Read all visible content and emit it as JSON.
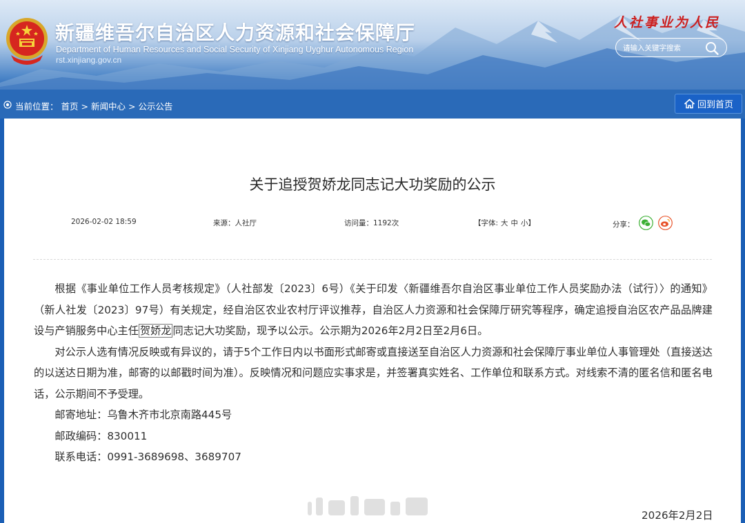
{
  "header": {
    "title_cn": "新疆维吾尔自治区人力资源和社会保障厅",
    "title_en": "Department of Human Resources and Social Security of Xinjiang Uyghur Autonomous Region",
    "url": "rst.xinjiang.gov.cn",
    "slogan": "人社事业为人民",
    "search_placeholder": "请输入关键字搜索",
    "search_icon": "search-icon",
    "emblem_icon": "national-emblem-icon",
    "brand_color": "#2a6ab8",
    "slogan_color": "#cc1f1f"
  },
  "breadcrumb": {
    "prefix": "当前位置：",
    "items": [
      "首页",
      "新闻中心",
      "公示公告"
    ],
    "separator": ">"
  },
  "home_button": {
    "label": "回到首页",
    "icon": "home-icon"
  },
  "article": {
    "title": "关于追授贺娇龙同志记大功奖励的公示",
    "date": "2026-02-02 18:59",
    "source": "来源：人社厅",
    "views": "访问量：1192次",
    "font_label": "【字体:",
    "font_sizes": [
      "大",
      "中",
      "小"
    ],
    "font_close": "】",
    "share_label": "分享：",
    "share_icons": [
      "wechat-icon",
      "weibo-icon"
    ],
    "p1_a": "根据《事业单位工作人员考核规定》（人社部发〔2023〕6号）《关于印发〈新疆维吾尔自治区事业单位工作人员奖励办法（试行）〉的通知》（新人社发〔2023〕97号）有关规定，经自治区农业农村厅评议推荐，自治区人力资源和社会保障厅研究等程序，确定追授自治区农产品品牌建设与产销服务中心主任",
    "p1_name": "贺娇龙",
    "p1_b": "同志记大功奖励，现予以公示。公示期为2026年2月2日至2月6日。",
    "p2": "对公示人选有情况反映或有异议的，请于5个工作日内以书面形式邮寄或直接送至自治区人力资源和社会保障厅事业单位人事管理处（直接送达的以送达日期为准，邮寄的以邮戳时间为准）。反映情况和问题应实事求是，并签署真实姓名、工作单位和联系方式。对线索不清的匿名信和匿名电话，公示期间不予受理。",
    "address": "邮寄地址：乌鲁木齐市北京南路445号",
    "postcode": "邮政编码：830011",
    "phone": "联系电话：0991-3689698、3689707",
    "sign_date": "2026年2月2日"
  }
}
